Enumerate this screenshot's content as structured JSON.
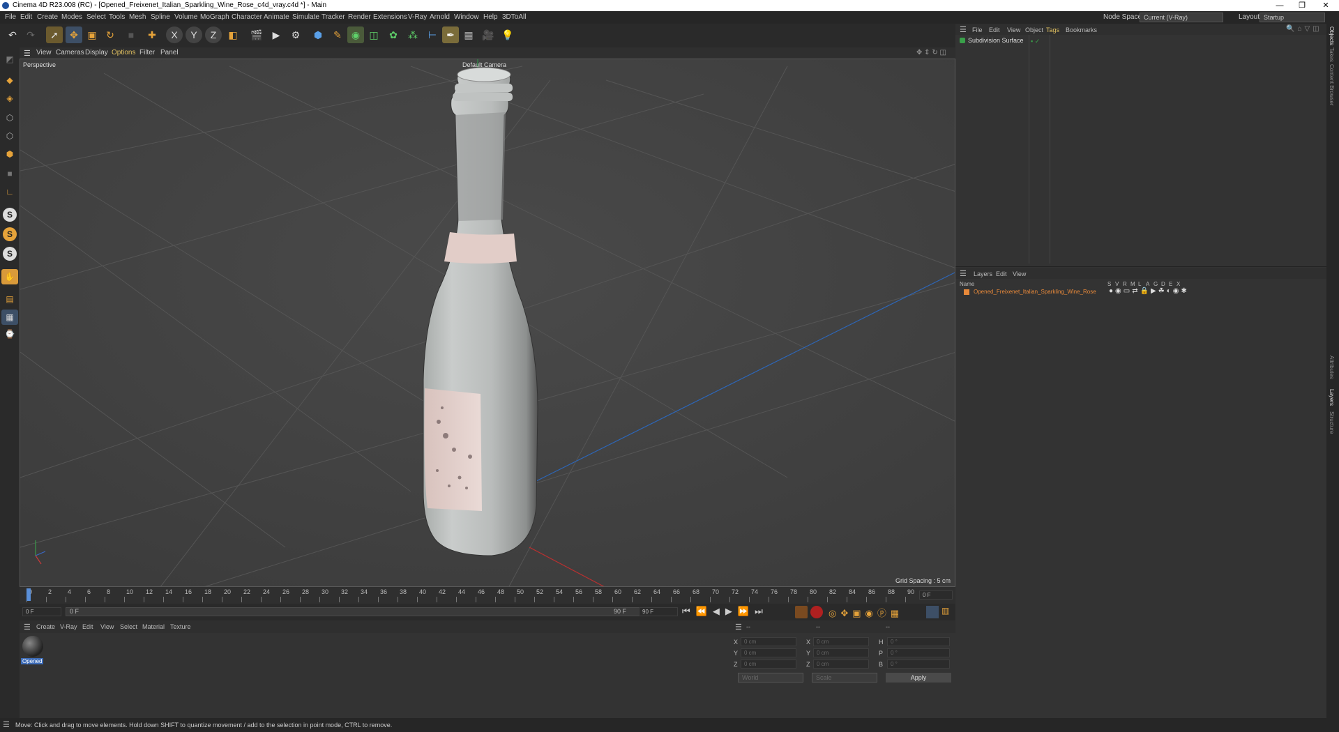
{
  "window": {
    "title": "Cinema 4D R23.008 (RC) - [Opened_Freixenet_Italian_Sparkling_Wine_Rose_c4d_vray.c4d *] - Main",
    "controls": [
      "—",
      "❐",
      "✕"
    ]
  },
  "menubar": {
    "items": [
      "File",
      "Edit",
      "Create",
      "Modes",
      "Select",
      "Tools",
      "Mesh",
      "Spline",
      "Volume",
      "MoGraph",
      "Character",
      "Animate",
      "Simulate",
      "Tracker",
      "Render",
      "Extensions",
      "V-Ray",
      "Arnold",
      "Window",
      "Help",
      "3DToAll"
    ],
    "node_space_label": "Node Space:",
    "node_space_value": "Current (V-Ray)",
    "layout_label": "Layout:",
    "layout_value": "Startup"
  },
  "viewport": {
    "menu": [
      "View",
      "Cameras",
      "Display",
      "Options",
      "Filter",
      "Panel"
    ],
    "label": "Perspective",
    "camera": "Default Camera",
    "grid_spacing": "Grid Spacing : 5 cm"
  },
  "timeline": {
    "ticks": [
      "0",
      "2",
      "4",
      "6",
      "8",
      "10",
      "12",
      "14",
      "16",
      "18",
      "20",
      "22",
      "24",
      "26",
      "28",
      "30",
      "32",
      "34",
      "36",
      "38",
      "40",
      "42",
      "44",
      "46",
      "48",
      "50",
      "52",
      "54",
      "56",
      "58",
      "60",
      "62",
      "64",
      "66",
      "68",
      "70",
      "72",
      "74",
      "76",
      "78",
      "80",
      "82",
      "84",
      "86",
      "88",
      "90"
    ],
    "current_frame": "0 F",
    "start_field": "0 F",
    "range_start": "0 F",
    "range_end": "90 F",
    "end_field": "90 F"
  },
  "material_manager": {
    "menu": [
      "Create",
      "V-Ray",
      "Edit",
      "View",
      "Select",
      "Material",
      "Texture"
    ],
    "material_name": "Opened"
  },
  "coordinates": {
    "header": [
      "--",
      "--",
      "--"
    ],
    "rows": [
      {
        "a": "X",
        "av": "0 cm",
        "b": "X",
        "bv": "0 cm",
        "c": "H",
        "cv": "0 °"
      },
      {
        "a": "Y",
        "av": "0 cm",
        "b": "Y",
        "bv": "0 cm",
        "c": "P",
        "cv": "0 °"
      },
      {
        "a": "Z",
        "av": "0 cm",
        "b": "Z",
        "bv": "0 cm",
        "c": "B",
        "cv": "0 °"
      }
    ],
    "mode": "World",
    "scale": "Scale",
    "apply": "Apply"
  },
  "objects": {
    "menu": [
      "File",
      "Edit",
      "View",
      "Object",
      "Tags",
      "Bookmarks"
    ],
    "item": "Subdivision Surface"
  },
  "layers": {
    "menu": [
      "Layers",
      "Edit",
      "View"
    ],
    "name_header": "Name",
    "flags": [
      "S",
      "V",
      "R",
      "M",
      "L",
      "A",
      "G",
      "D",
      "E",
      "X"
    ],
    "layer_name": "Opened_Freixenet_Italian_Sparkling_Wine_Rose"
  },
  "side_tabs": {
    "top": [
      "Objects",
      "Takes",
      "Content Browser"
    ],
    "bottom": [
      "Attributes",
      "Layers",
      "Structure"
    ]
  },
  "status": "Move: Click and drag to move elements. Hold down SHIFT to quantize movement / add to the selection in point mode, CTRL to remove.",
  "colors": {
    "accent": "#e07a2a",
    "select_blue": "#5a8fd8",
    "layer_orange": "#e8893a"
  }
}
